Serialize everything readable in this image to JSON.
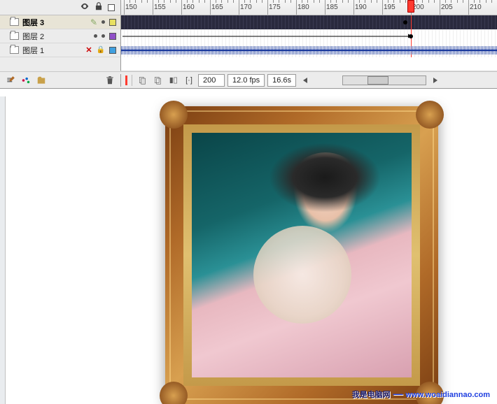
{
  "timeline": {
    "ruler_start": 150,
    "ruler_end": 215,
    "ruler_step": 5,
    "playhead_frame": 200,
    "pixels_per_frame": 8.2,
    "layers": [
      {
        "name": "图层 3",
        "selected": true,
        "color": "#e8e060",
        "mode": "pencil",
        "content": "tween"
      },
      {
        "name": "图层 2",
        "selected": false,
        "color": "#9050c8",
        "mode": "dot",
        "content": "motion"
      },
      {
        "name": "图层 1",
        "selected": false,
        "color": "#40a0e0",
        "mode": "xlock",
        "content": "audio"
      }
    ]
  },
  "footer": {
    "frame": "200",
    "fps": "12.0 fps",
    "time": "16.6s"
  },
  "watermark": {
    "cn": "我是电脑网",
    "url": "www.woaidiannao.com"
  }
}
